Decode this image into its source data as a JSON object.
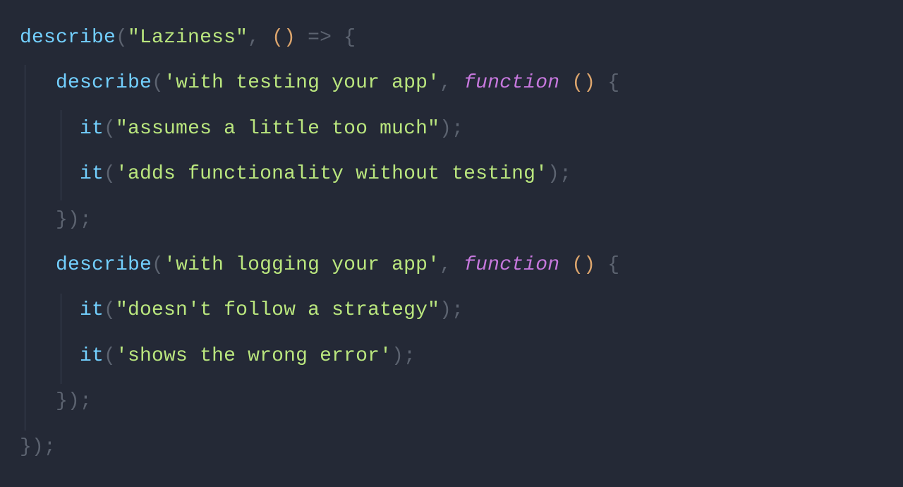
{
  "tokens": {
    "describe": "describe",
    "it": "it",
    "function": "function",
    "arrow": "=>",
    "lparen_g": "(",
    "rparen_g": ")",
    "lparen_o": "(",
    "rparen_o": ")",
    "lbrace": "{",
    "rbrace": "}",
    "semi": ";",
    "comma": ","
  },
  "strings": {
    "s1": "\"Laziness\"",
    "s2": "'with testing your app'",
    "s3": "\"assumes a little too much\"",
    "s4": "'adds functionality without testing'",
    "s5": "'with logging your app'",
    "s6": "\"doesn't follow a strategy\"",
    "s7": "'shows the wrong error'"
  }
}
